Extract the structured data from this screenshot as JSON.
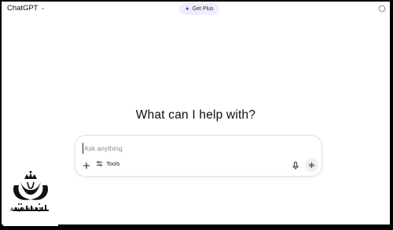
{
  "header": {
    "model_label": "ChatGPT",
    "get_plus_label": "Get Plus"
  },
  "main": {
    "heading": "What can I help with?"
  },
  "composer": {
    "placeholder": "Ask anything",
    "tools_label": "Tools"
  },
  "watermark": {
    "arabic_text": "ثبت آشنا",
    "latin_text": "ASHA SABT"
  },
  "colors": {
    "accent": "#5147e6",
    "plus_bg": "#eeeefe",
    "text": "#0d0d0d"
  }
}
